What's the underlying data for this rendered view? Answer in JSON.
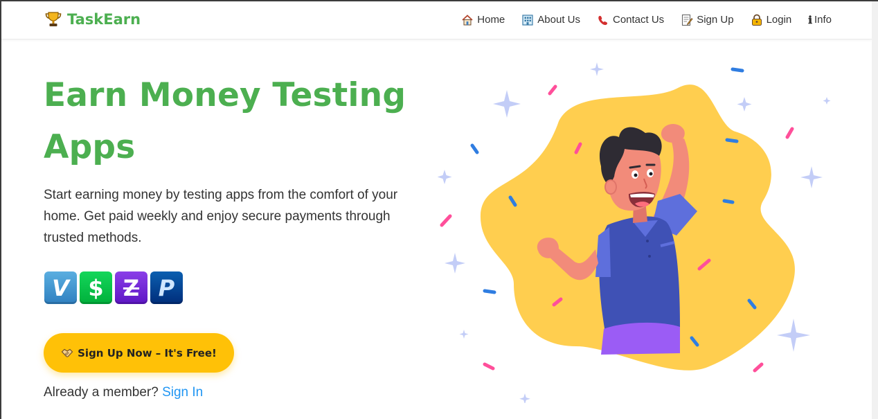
{
  "brand": {
    "name": "TaskEarn",
    "icon": "trophy-icon",
    "color": "#4caf50"
  },
  "nav": {
    "items": [
      {
        "label": "Home",
        "icon": "house-icon"
      },
      {
        "label": "About Us",
        "icon": "building-icon"
      },
      {
        "label": "Contact Us",
        "icon": "telephone-icon"
      },
      {
        "label": "Sign Up",
        "icon": "memo-icon"
      },
      {
        "label": "Login",
        "icon": "lock-key-icon"
      },
      {
        "label": "Info",
        "icon": "info-icon",
        "glyph": "ℹ"
      }
    ]
  },
  "hero": {
    "title": "Earn Money Testing Apps",
    "description": "Start earning money by testing apps from the comfort of your home. Get paid weekly and enjoy secure payments through trusted methods.",
    "payments": [
      {
        "name": "Venmo",
        "glyph": "V",
        "color": "#3d95ce",
        "icon": "venmo-icon"
      },
      {
        "name": "Cash App",
        "glyph": "$",
        "color": "#00c244",
        "icon": "cashapp-icon"
      },
      {
        "name": "Zelle",
        "glyph": "Z",
        "color": "#6d1ed4",
        "icon": "zelle-icon"
      },
      {
        "name": "PayPal",
        "glyph": "P",
        "color": "#003087",
        "icon": "paypal-icon"
      }
    ],
    "cta": {
      "label": "Sign Up Now – It's Free!",
      "icon": "handshake-icon",
      "color": "#ffc107"
    },
    "member_text": "Already a member?",
    "signin_label": "Sign In"
  },
  "illustration": {
    "subject": "celebrating-man-illustration",
    "blob_color": "#ffce4f",
    "shirt_color": "#3f51b5",
    "confetti_colors": [
      "#ff4f9a",
      "#2f7de1"
    ]
  }
}
